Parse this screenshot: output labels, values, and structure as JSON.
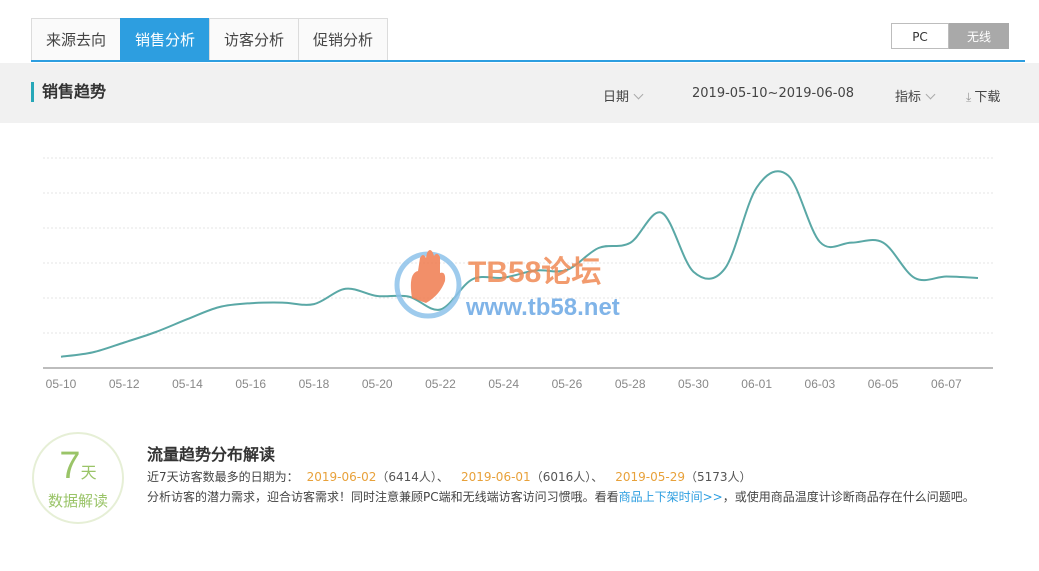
{
  "tabs": [
    {
      "label": "来源去向"
    },
    {
      "label": "销售分析"
    },
    {
      "label": "访客分析"
    },
    {
      "label": "促销分析"
    }
  ],
  "device_toggle": {
    "pc": "PC",
    "wireless": "无线",
    "selected": "无线"
  },
  "toolbar": {
    "title": "销售趋势",
    "date_label": "日期",
    "date_range": "2019-05-10~2019-06-08",
    "metric_label": "指标",
    "download_label": "下载"
  },
  "watermark": {
    "cn": "TB58论坛",
    "url": "www.tb58.net"
  },
  "colors": {
    "accent": "#2d9ee0",
    "line": "#5aa8a6",
    "highlight": "#e8a13a",
    "badge": "#9ac468"
  },
  "chart_data": {
    "type": "line",
    "x": [
      "05-10",
      "05-11",
      "05-12",
      "05-13",
      "05-14",
      "05-15",
      "05-16",
      "05-17",
      "05-18",
      "05-19",
      "05-20",
      "05-21",
      "05-22",
      "05-23",
      "05-24",
      "05-25",
      "05-26",
      "05-27",
      "05-28",
      "05-29",
      "05-30",
      "05-31",
      "06-01",
      "06-02",
      "06-03",
      "06-04",
      "06-05",
      "06-06",
      "06-07",
      "06-08"
    ],
    "x_tick_labels": [
      "05-10",
      "05-12",
      "05-14",
      "05-16",
      "05-18",
      "05-20",
      "05-22",
      "05-24",
      "05-26",
      "05-28",
      "05-30",
      "06-01",
      "06-03",
      "06-05",
      "06-07"
    ],
    "series": [
      {
        "values": [
          375,
          520,
          850,
          1200,
          1630,
          2030,
          2160,
          2180,
          2130,
          2640,
          2400,
          2380,
          1950,
          2950,
          3010,
          3250,
          3270,
          4000,
          4170,
          5173,
          3210,
          3320,
          6016,
          6414,
          4200,
          4180,
          4180,
          3000,
          3050,
          3000
        ]
      }
    ],
    "ylim": [
      0,
      7000
    ],
    "grid": true
  },
  "badge": {
    "number": "7",
    "unit": "天",
    "label": "数据解读"
  },
  "interpretation": {
    "title": "流量趋势分布解读",
    "intro": "近7天访客数最多的日期为：",
    "top_days": [
      {
        "date": "2019-06-02",
        "count": "（6414人）、"
      },
      {
        "date": "2019-06-01",
        "count": "（6016人）、"
      },
      {
        "date": "2019-05-29",
        "count": "（5173人）"
      }
    ],
    "line2_pre": "分析访客的潜力需求，迎合访客需求！同时注意兼顾PC端和无线端访客访问习惯哦。看看",
    "line2_link": "商品上下架时间>>",
    "line2_post": "，或使用商品温度计诊断商品存在什么问题吧。"
  }
}
